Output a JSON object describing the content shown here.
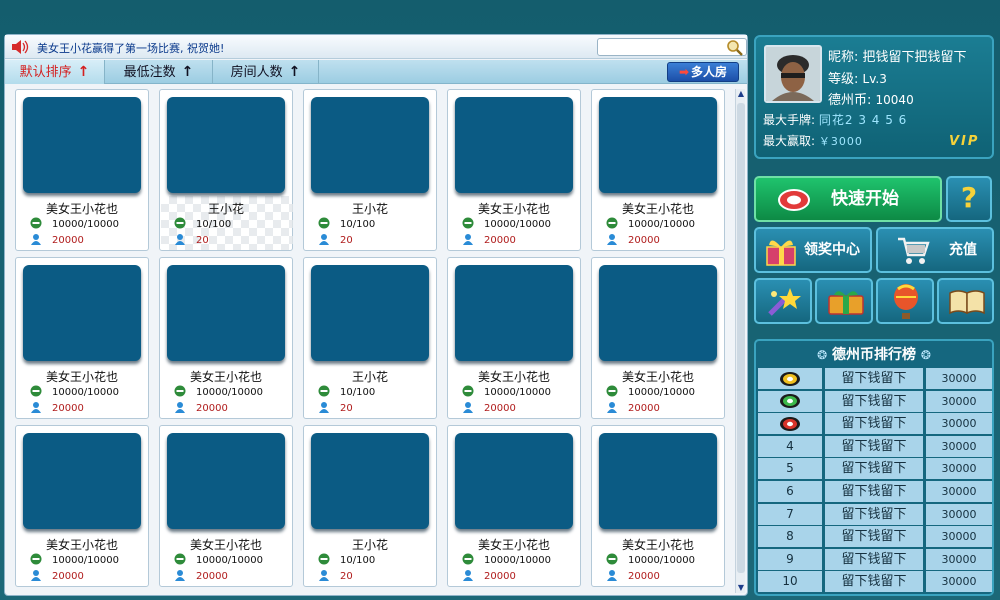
{
  "notice": {
    "text": "美女王小花赢得了第一场比赛, 祝贺她!"
  },
  "search": {
    "placeholder": ""
  },
  "sort_tabs": [
    {
      "label": "默认排序",
      "arrow": "↑",
      "active": true
    },
    {
      "label": "最低注数",
      "arrow": "↑",
      "active": false
    },
    {
      "label": "房间人数",
      "arrow": "↑",
      "active": false
    }
  ],
  "multi_button": {
    "label": "多人房",
    "arrow": "➡"
  },
  "rooms": [
    {
      "name": "美女王小花也",
      "limit": "10000/10000",
      "people": "20000"
    },
    {
      "name": "王小花",
      "limit": "10/100",
      "people": "20"
    },
    {
      "name": "王小花",
      "limit": "10/100",
      "people": "20"
    },
    {
      "name": "美女王小花也",
      "limit": "10000/10000",
      "people": "20000"
    },
    {
      "name": "美女王小花也",
      "limit": "10000/10000",
      "people": "20000"
    },
    {
      "name": "美女王小花也",
      "limit": "10000/10000",
      "people": "20000"
    },
    {
      "name": "美女王小花也",
      "limit": "10000/10000",
      "people": "20000"
    },
    {
      "name": "王小花",
      "limit": "10/100",
      "people": "20"
    },
    {
      "name": "美女王小花也",
      "limit": "10000/10000",
      "people": "20000"
    },
    {
      "name": "美女王小花也",
      "limit": "10000/10000",
      "people": "20000"
    },
    {
      "name": "美女王小花也",
      "limit": "10000/10000",
      "people": "20000"
    },
    {
      "name": "美女王小花也",
      "limit": "10000/10000",
      "people": "20000"
    },
    {
      "name": "王小花",
      "limit": "10/100",
      "people": "20"
    },
    {
      "name": "美女王小花也",
      "limit": "10000/10000",
      "people": "20000"
    },
    {
      "name": "美女王小花也",
      "limit": "10000/10000",
      "people": "20000"
    }
  ],
  "profile": {
    "nickname_label": "昵称:",
    "nickname": "把钱留下把钱留下",
    "level_label": "等级:",
    "level": "Lv.3",
    "coins_label": "德州币:",
    "coins": "10040",
    "best_hand_label": "最大手牌:",
    "best_hand": "同花2 3 4 5 6",
    "max_win_label": "最大赢取:",
    "max_win": "￥3000",
    "vip": "VIP"
  },
  "buttons": {
    "quick_start": "快速开始",
    "help": "?",
    "reward_center": "领奖中心",
    "recharge": "充值"
  },
  "tools": [
    "star-tool-icon",
    "gift-box-icon",
    "balloon-icon",
    "book-icon"
  ],
  "ranking": {
    "title": "德州币排行榜",
    "rows": [
      {
        "rank": "",
        "medal": "gold",
        "name": "留下钱留下",
        "coins": "30000"
      },
      {
        "rank": "",
        "medal": "silver",
        "name": "留下钱留下",
        "coins": "30000"
      },
      {
        "rank": "",
        "medal": "bronze",
        "name": "留下钱留下",
        "coins": "30000"
      },
      {
        "rank": "4",
        "name": "留下钱留下",
        "coins": "30000"
      },
      {
        "rank": "5",
        "name": "留下钱留下",
        "coins": "30000"
      },
      {
        "rank": "6",
        "name": "留下钱留下",
        "coins": "30000"
      },
      {
        "rank": "7",
        "name": "留下钱留下",
        "coins": "30000"
      },
      {
        "rank": "8",
        "name": "留下钱留下",
        "coins": "30000"
      },
      {
        "rank": "9",
        "name": "留下钱留下",
        "coins": "30000"
      },
      {
        "rank": "10",
        "name": "留下钱留下",
        "coins": "30000"
      }
    ]
  },
  "colors": {
    "table": "#0b5b84",
    "accent_red": "#d42020",
    "vip_gold": "#f5d23a"
  }
}
